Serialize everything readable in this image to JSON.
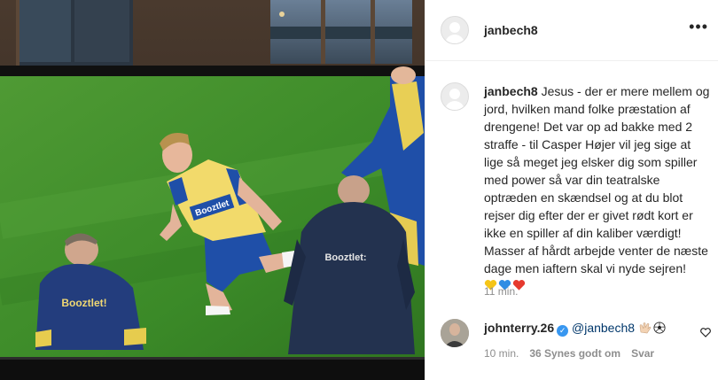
{
  "post": {
    "author": "janbech8",
    "more_icon": "more-options-icon",
    "caption_author": "janbech8",
    "caption_text": "Jesus - der er mere mellem og jord, hvilken mand folke præstation af drengene! Det var op ad bakke med 2 straffe - til Casper Højer vil jeg sige at lige så meget jeg elsker dig som spiller med power så var din teatralske optræden en skændsel og at du blot rejser dig efter der er givet rødt kort er ikke en spiller af din kaliber værdigt! Masser af hårdt arbejde venter de næste dage men iaftern skal vi nyde sejren!",
    "caption_emojis": [
      "yellow-heart",
      "blue-heart",
      "red-heart"
    ],
    "time_ago": "11 min."
  },
  "photo": {
    "jersey_text_1": "Booztlet",
    "jersey_text_2": "Booztlet!",
    "jersey_text_3": "Booztlet:"
  },
  "comment": {
    "author": "johnterry.26",
    "verified_icon": "verified-badge-icon",
    "mention": "@janbech8",
    "emojis": [
      "clapping-hands",
      "soccer-ball"
    ],
    "time_ago": "10 min.",
    "likes": "36 Synes godt om",
    "reply_label": "Svar"
  },
  "colors": {
    "text": "#262626",
    "secondary": "#8e8e8e",
    "link": "#00376b",
    "verified": "#3897f0",
    "pitch": "#3d8b2a",
    "jersey_yellow": "#f2da6b",
    "kit_blue": "#1f4fa8"
  }
}
